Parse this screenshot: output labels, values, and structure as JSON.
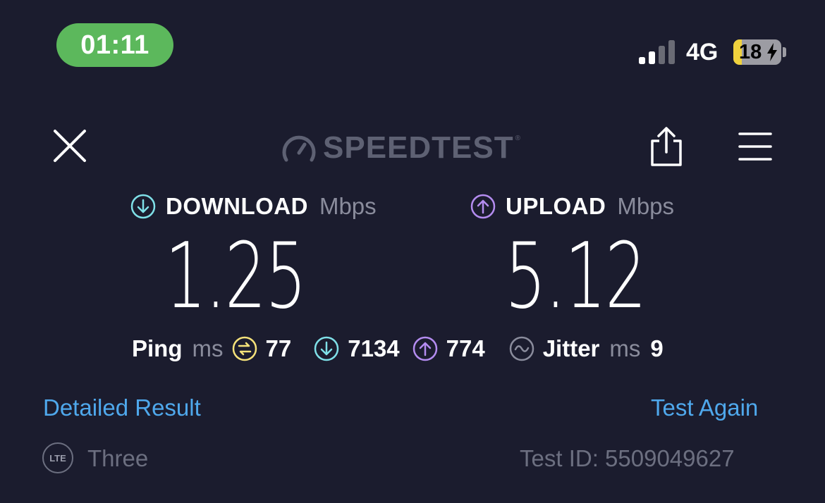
{
  "status_bar": {
    "time": "01:11",
    "network": "4G",
    "battery_level": "18",
    "battery_fraction": 0.18
  },
  "header": {
    "logo_text": "SPEEDTEST",
    "logo_mark": "®",
    "icons": [
      "close-icon",
      "speedometer-icon",
      "share-icon",
      "menu-icon"
    ]
  },
  "download": {
    "label": "DOWNLOAD",
    "unit": "Mbps",
    "value": "1.25",
    "icon": "download-arrow-icon",
    "color": "#7fe0e8"
  },
  "upload": {
    "label": "UPLOAD",
    "unit": "Mbps",
    "value": "5.12",
    "icon": "upload-arrow-icon",
    "color": "#b48cf0"
  },
  "ping": {
    "label": "Ping",
    "unit": "ms",
    "idle": "77",
    "download": "7134",
    "upload": "774",
    "idle_color": "#f5e27a"
  },
  "jitter": {
    "label": "Jitter",
    "unit": "ms",
    "value": "9",
    "icon": "jitter-wave-icon"
  },
  "links": {
    "detailed": "Detailed Result",
    "again": "Test Again"
  },
  "footer": {
    "connection_badge": "LTE",
    "carrier": "Three",
    "test_id": "Test ID: 5509049627"
  },
  "colors": {
    "background": "#1b1c2e",
    "link": "#4fa8ec",
    "muted": "#8a8c9c",
    "time_pill": "#5cb85c"
  }
}
